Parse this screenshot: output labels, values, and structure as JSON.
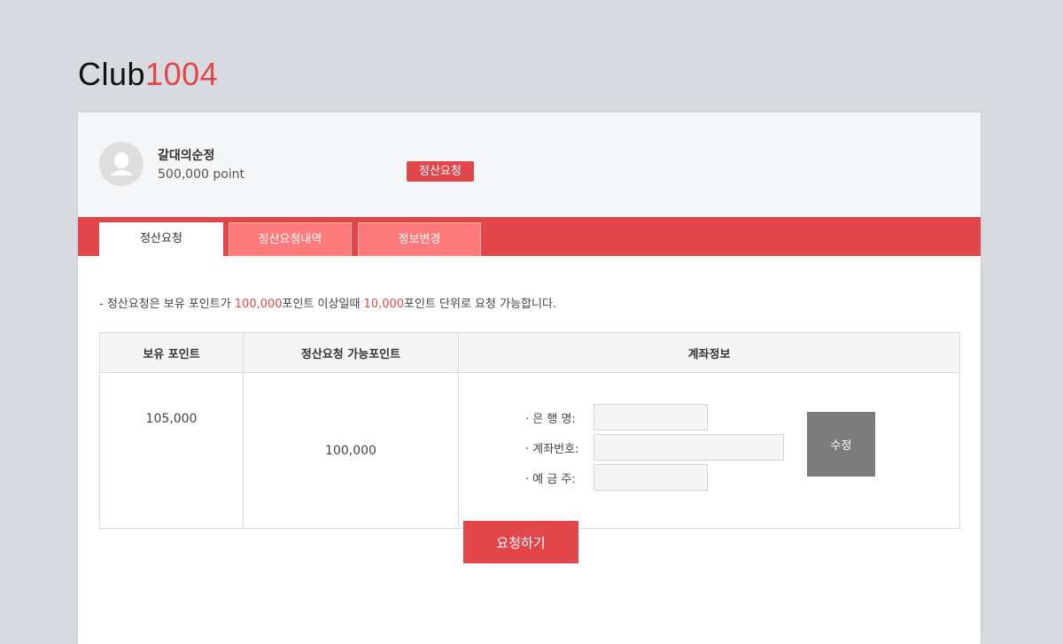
{
  "logo": {
    "part1": "Club",
    "part2": "1004"
  },
  "user": {
    "name": "갈대의순정",
    "points": "500,000 point",
    "badge": "정산요청"
  },
  "tabs": [
    {
      "label": "정산요청",
      "active": true
    },
    {
      "label": "정산요청내역",
      "active": false
    },
    {
      "label": "정보변경",
      "active": false
    }
  ],
  "notice": {
    "prefix": "- 정산요청은 보유 포인트가 ",
    "min_points": "100,000",
    "middle": "포인트 이상일때 ",
    "unit_points": "10,000",
    "suffix": "포인트 단위로 요청 가능합니다."
  },
  "table": {
    "headers": [
      "보유 포인트",
      "정산요청 가능포인트",
      "계좌정보"
    ],
    "held_points": "105,000",
    "requestable_points": "100,000"
  },
  "account": {
    "bank_label": "· 은  행  명:",
    "bank_value": "",
    "number_label": "· 계좌번호:",
    "number_value": "",
    "holder_label": "· 예  금  주:",
    "holder_value": "",
    "edit_button": "수정"
  },
  "submit_button": "요청하기",
  "colors": {
    "accent": "#e0464a",
    "tab_inactive": "#ff7b7b",
    "edit_button": "#7d7d7d"
  }
}
